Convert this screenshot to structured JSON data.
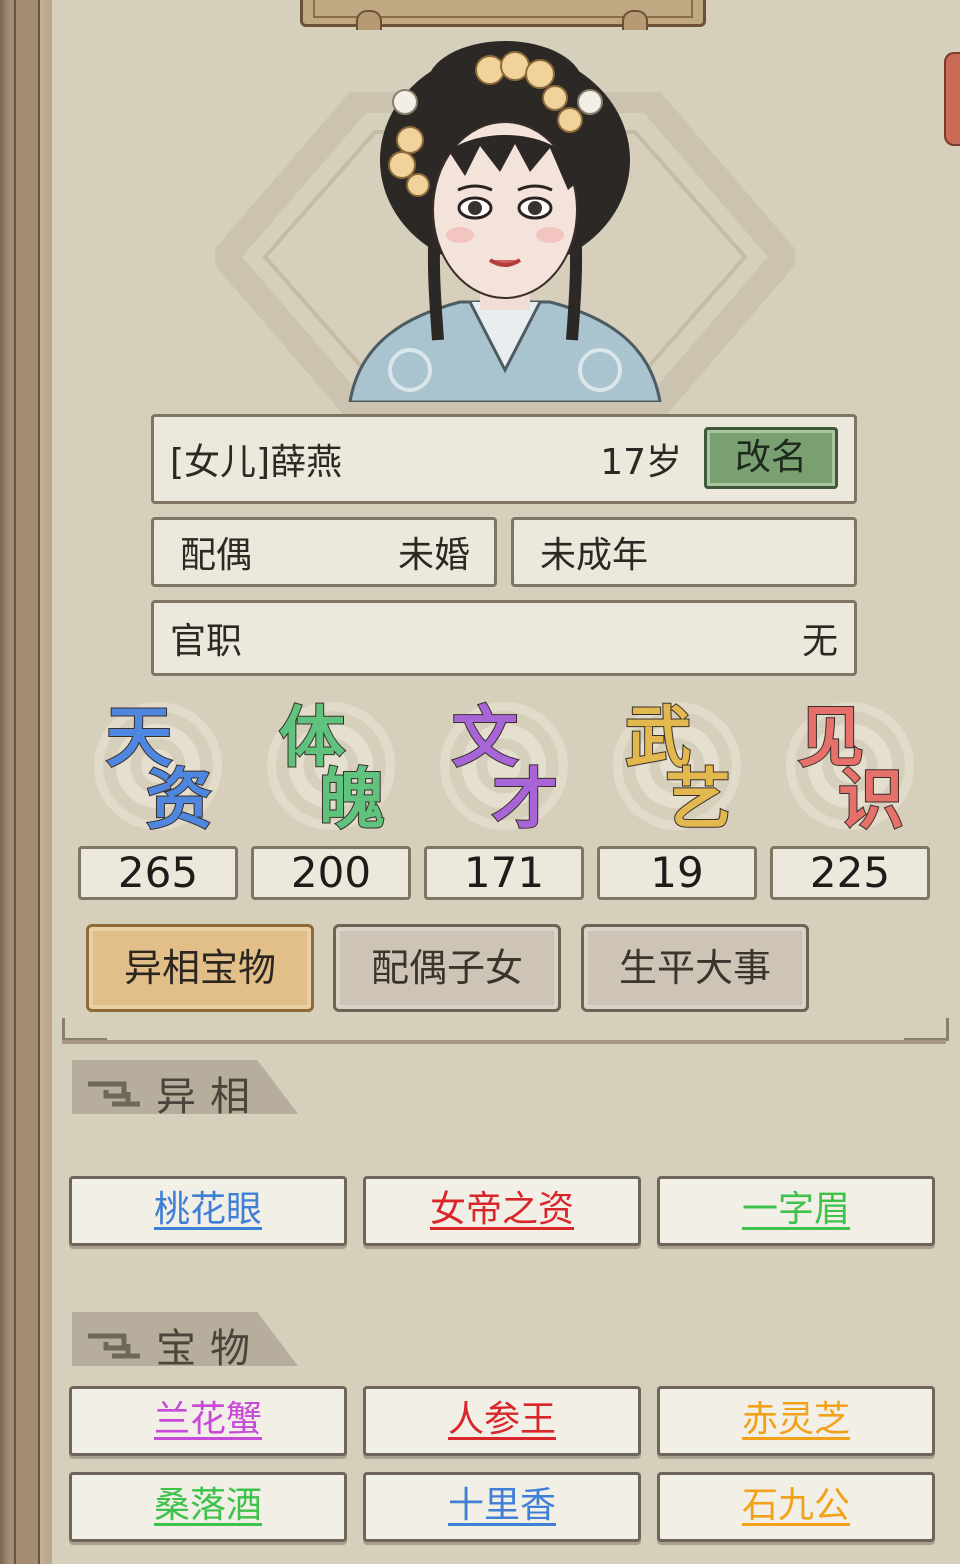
{
  "profile": {
    "relation_name": "[女儿]薛燕",
    "age": "17岁",
    "rename_label": "改名",
    "spouse_label": "配偶",
    "spouse_value": "未婚",
    "status": "未成年",
    "office_label": "官职",
    "office_value": "无"
  },
  "stats": [
    {
      "c1": "天",
      "c2": "资",
      "value": "265",
      "color": "#4f87e0"
    },
    {
      "c1": "体",
      "c2": "魄",
      "value": "200",
      "color": "#5fc37e"
    },
    {
      "c1": "文",
      "c2": "才",
      "value": "171",
      "color": "#a865d8"
    },
    {
      "c1": "武",
      "c2": "艺",
      "value": "19",
      "color": "#e2b84f"
    },
    {
      "c1": "见",
      "c2": "识",
      "value": "225",
      "color": "#e5716a"
    }
  ],
  "tabs": [
    "异相宝物",
    "配偶子女",
    "生平大事"
  ],
  "sections": {
    "traits_title": "异相",
    "treasures_title": "宝物"
  },
  "traits": [
    {
      "label": "桃花眼",
      "color": "#3f7fd6"
    },
    {
      "label": "女帝之资",
      "color": "#d8262a"
    },
    {
      "label": "一字眉",
      "color": "#3ec24a"
    }
  ],
  "treasures": [
    {
      "label": "兰花蟹",
      "color": "#c84ad8"
    },
    {
      "label": "人参王",
      "color": "#d8262a"
    },
    {
      "label": "赤灵芝",
      "color": "#f2a21a"
    },
    {
      "label": "桑落酒",
      "color": "#3ec24a"
    },
    {
      "label": "十里香",
      "color": "#3f7fd6"
    },
    {
      "label": "石九公",
      "color": "#f2a21a"
    }
  ]
}
